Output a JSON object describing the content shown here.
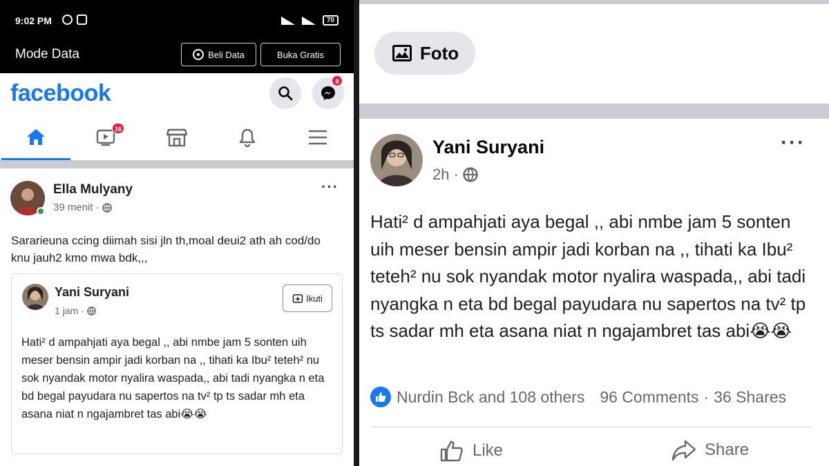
{
  "status_bar": {
    "time": "9:02 PM",
    "battery": "70"
  },
  "mode_bar": {
    "title": "Mode Data",
    "beli_label": "Beli Data",
    "buka_label": "Buka Gratis"
  },
  "header": {
    "logo": "facebook",
    "messenger_badge": "8"
  },
  "nav": {
    "watch_badge": "16",
    "active_tab": "home"
  },
  "post": {
    "author": "Ella Mulyany",
    "time": "39 menit",
    "privacy_icon": "globe-icon",
    "text": "Sararieuna ccing diimah sisi jln th,moal deui2 ath ah cod/do knu jauh2 kmo mwa bdk,,,"
  },
  "shared_post": {
    "author": "Yani Suryani",
    "time": "1 jam",
    "follow_label": "Ikuti",
    "text": "Hati² d ampahjati aya begal ,, abi nmbe jam 5 sonten uih meser bensin ampir jadi korban na ,, tihati ka Ibu² teteh² nu sok nyandak motor nyalira waspada,, abi tadi nyangka n eta bd begal payudara nu sapertos na tv² tp ts sadar mh eta asana niat n ngajambret tas abi",
    "emoji": "😭😭"
  },
  "right_panel": {
    "foto_label": "Foto",
    "author": "Yani Suryani",
    "time": "2h",
    "text": "Hati² d ampahjati aya begal ,, abi nmbe jam 5 sonten uih meser bensin ampir jadi korban na ,, tihati ka Ibu² teteh² nu sok nyandak motor nyalira waspada,, abi tadi nyangka n eta bd begal payudara nu sapertos na tv² tp ts sadar mh eta asana niat n ngajambret tas abi",
    "emoji": "😭😭",
    "reactions": "Nurdin Bck and 108 others",
    "comments": "96 Comments",
    "shares": "36 Shares",
    "like_label": "Like",
    "share_label": "Share"
  },
  "colors": {
    "brand": "#1877f2",
    "badge": "#e41e3f",
    "online": "#31a24c"
  }
}
